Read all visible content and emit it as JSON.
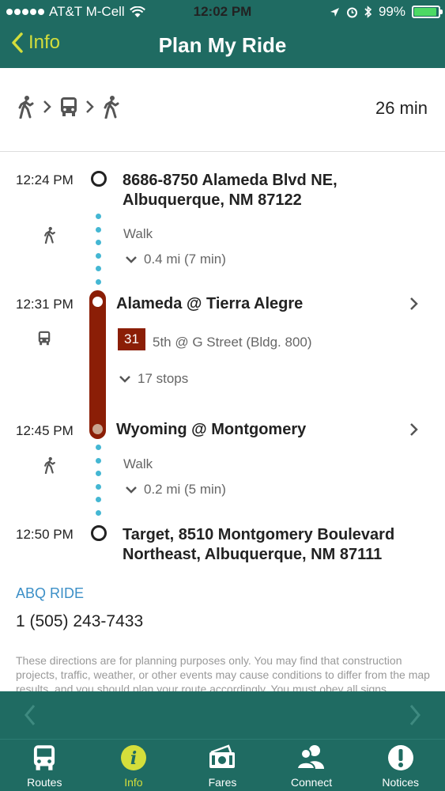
{
  "status_bar": {
    "carrier": "AT&T M-Cell",
    "time": "12:02 PM",
    "battery": "99%"
  },
  "nav": {
    "back_label": "Info",
    "title": "Plan My Ride"
  },
  "summary": {
    "modes": [
      "walk-icon",
      "bus-icon",
      "walk-icon"
    ],
    "duration": "26 min"
  },
  "timeline": {
    "origin": {
      "time": "12:24 PM",
      "line1": "8686-8750 Alameda Blvd NE,",
      "line2": "Albuquerque, NM 87122"
    },
    "walk1": {
      "label": "Walk",
      "detail": "0.4 mi (7 min)"
    },
    "board": {
      "time": "12:31 PM",
      "stop": "Alameda @ Tierra Alegre"
    },
    "bus": {
      "route": "31",
      "headsign": "5th @ G Street (Bldg. 800)",
      "stops": "17 stops",
      "color": "#8b1e06"
    },
    "alight": {
      "time": "12:45 PM",
      "stop": "Wyoming @ Montgomery"
    },
    "walk2": {
      "label": "Walk",
      "detail": "0.2 mi (5 min)"
    },
    "destination": {
      "time": "12:50 PM",
      "line1": "Target, 8510 Montgomery Boulevard",
      "line2": "Northeast, Albuquerque, NM 87111"
    }
  },
  "agency": {
    "name": "ABQ RIDE",
    "phone": "1 (505) 243-7433"
  },
  "disclaimer": "These directions are for planning purposes only. You may find that construction projects, traffic, weather, or other events may cause conditions to differ from the map results, and you should plan your route accordingly. You must obey all signs",
  "tabs": [
    {
      "label": "Routes",
      "icon": "bus-icon"
    },
    {
      "label": "Info",
      "icon": "info-icon",
      "active": true
    },
    {
      "label": "Fares",
      "icon": "fares-icon"
    },
    {
      "label": "Connect",
      "icon": "people-icon"
    },
    {
      "label": "Notices",
      "icon": "alert-icon"
    }
  ],
  "colors": {
    "header": "#1f6b62",
    "accent": "#d4de3b",
    "walk_dots": "#44b7d3",
    "link": "#3b8fc7"
  }
}
